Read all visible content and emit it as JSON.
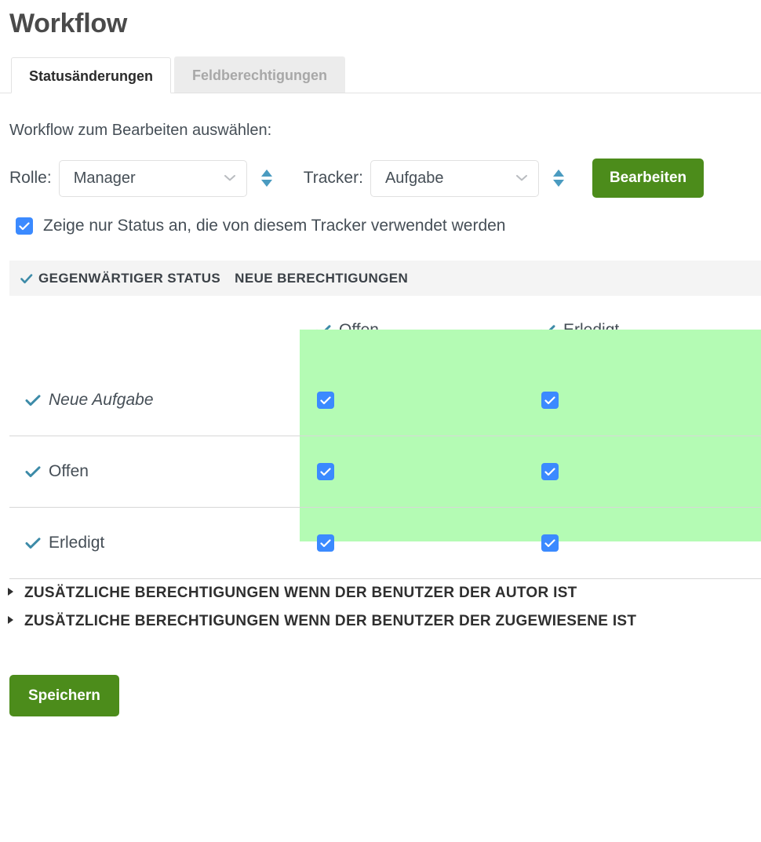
{
  "page": {
    "title": "Workflow"
  },
  "tabs": [
    {
      "label": "Statusänderungen",
      "active": true
    },
    {
      "label": "Feldberechtigungen",
      "active": false
    }
  ],
  "intro": "Workflow zum Bearbeiten auswählen:",
  "selector": {
    "role_label": "Rolle:",
    "role_value": "Manager",
    "tracker_label": "Tracker:",
    "tracker_value": "Aufgabe",
    "edit_button": "Bearbeiten",
    "chevron_icon": "chevron-down-icon",
    "sort_icon": "sort-updown-icon"
  },
  "filter": {
    "checkbox_checked": true,
    "label": "Zeige nur Status an, die von diesem Tracker verwendet werden"
  },
  "table": {
    "header": {
      "current_status": "GEGENWÄRTIGER STATUS",
      "new_permissions": "NEUE BERECHTIGUNGEN",
      "tick_icon": "check-icon"
    },
    "columns": [
      {
        "label": "Offen"
      },
      {
        "label": "Erledigt"
      }
    ],
    "rows": [
      {
        "label": "Neue Aufgabe",
        "italic": true,
        "cells": [
          true,
          true
        ]
      },
      {
        "label": "Offen",
        "italic": false,
        "cells": [
          true,
          true
        ]
      },
      {
        "label": "Erledigt",
        "italic": false,
        "cells": [
          true,
          true
        ]
      }
    ]
  },
  "sections": [
    {
      "label": "ZUSÄTZLICHE BERECHTIGUNGEN WENN DER BENUTZER DER AUTOR IST",
      "expanded": false
    },
    {
      "label": "ZUSÄTZLICHE BERECHTIGUNGEN WENN DER BENUTZER DER ZUGEWIESENE IST",
      "expanded": false
    }
  ],
  "save_button": "Speichern",
  "colors": {
    "green_button": "#4c8c1b",
    "row_highlight": "#b4fbb4",
    "checkbox_blue": "#3b8aff",
    "tick_teal": "#3d8ba8",
    "sort_teal": "#4a9bc0",
    "header_gray": "#f4f4f4"
  }
}
